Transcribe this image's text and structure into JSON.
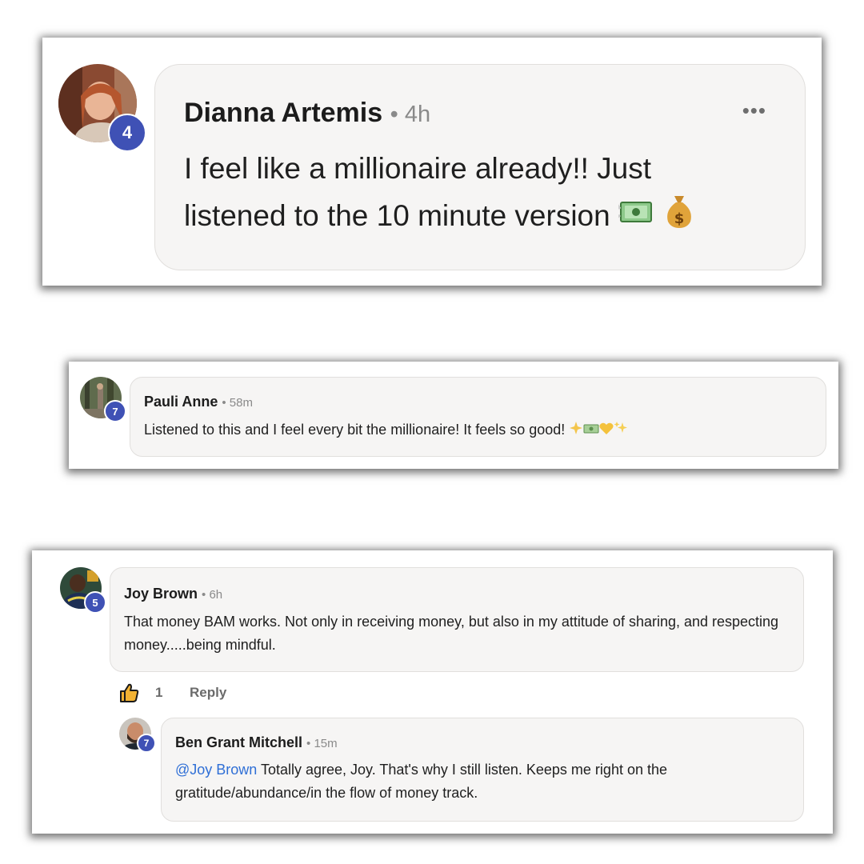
{
  "comments": [
    {
      "author": "Dianna Artemis",
      "meta": "• 4h",
      "level": "4",
      "text": "I feel like a millionaire already!! Just listened to the 10 minute version",
      "emoji": [
        "money-with-wings",
        "money-bag"
      ],
      "more_label": "•••"
    },
    {
      "author": "Pauli Anne",
      "meta": "• 58m",
      "level": "7",
      "text": "Listened to this and I feel every bit the millionaire! It feels so good!",
      "emoji": [
        "sparkle",
        "money",
        "yellow-heart",
        "sparkles"
      ]
    },
    {
      "author": "Joy Brown",
      "meta": "• 6h",
      "level": "5",
      "text": "That money BAM works. Not only in receiving money, but also in my attitude of sharing, and respecting money.....being mindful.",
      "like_count": "1",
      "reply_label": "Reply",
      "reply": {
        "author": "Ben Grant Mitchell",
        "meta": "• 15m",
        "level": "7",
        "mention": "@Joy Brown",
        "text": " Totally agree, Joy. That's why I still listen. Keeps me right on the gratitude/abundance/in the flow of money track."
      }
    }
  ],
  "colors": {
    "badge": "#3f51b5",
    "mention": "#2f6fd6",
    "bubble": "#f6f5f4"
  }
}
